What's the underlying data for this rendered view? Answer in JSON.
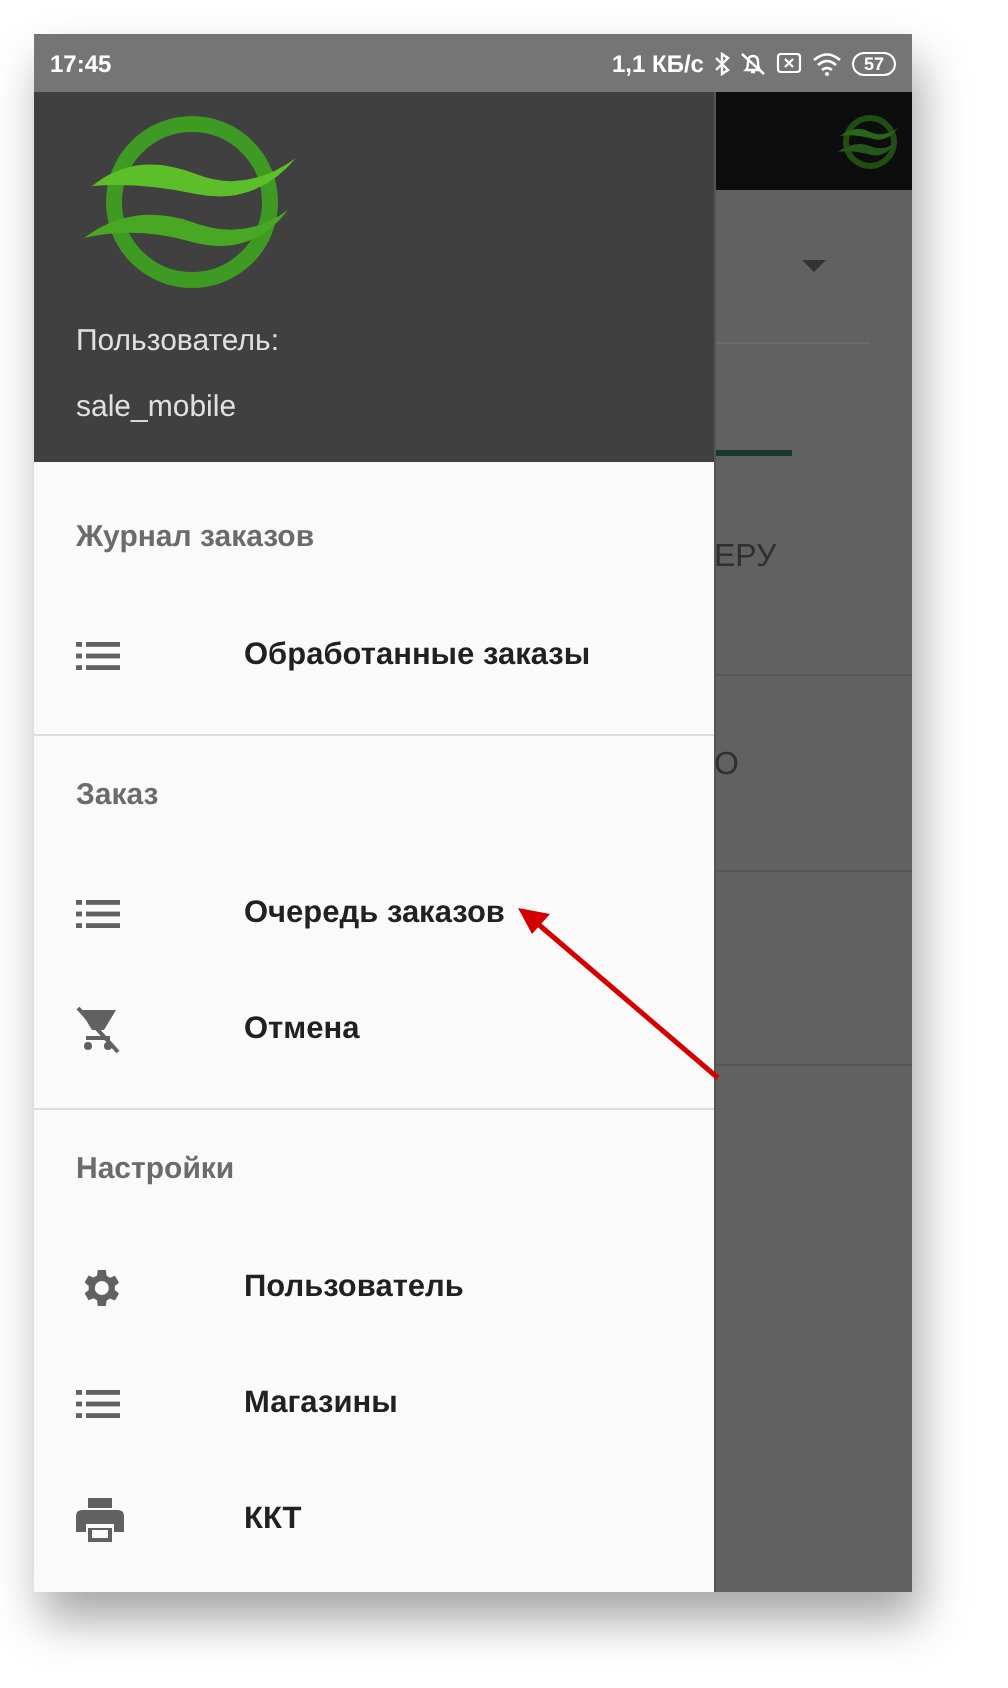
{
  "status_bar": {
    "time": "17:45",
    "network_speed": "1,1 КБ/с",
    "battery": "57"
  },
  "drawer": {
    "user_label": "Пользователь:",
    "user_name": "sale_mobile",
    "sections": [
      {
        "title": "Журнал заказов",
        "items": [
          {
            "label": "Обработанные заказы",
            "kind": "list"
          }
        ]
      },
      {
        "title": "Заказ",
        "items": [
          {
            "label": "Очередь заказов",
            "kind": "list"
          },
          {
            "label": "Отмена",
            "kind": "cartoff"
          }
        ]
      },
      {
        "title": "Настройки",
        "items": [
          {
            "label": "Пользователь",
            "kind": "gear"
          },
          {
            "label": "Магазины",
            "kind": "list"
          },
          {
            "label": "ККТ",
            "kind": "printer"
          }
        ]
      }
    ]
  },
  "background": {
    "texts": [
      "ЕРУ",
      "О"
    ]
  }
}
